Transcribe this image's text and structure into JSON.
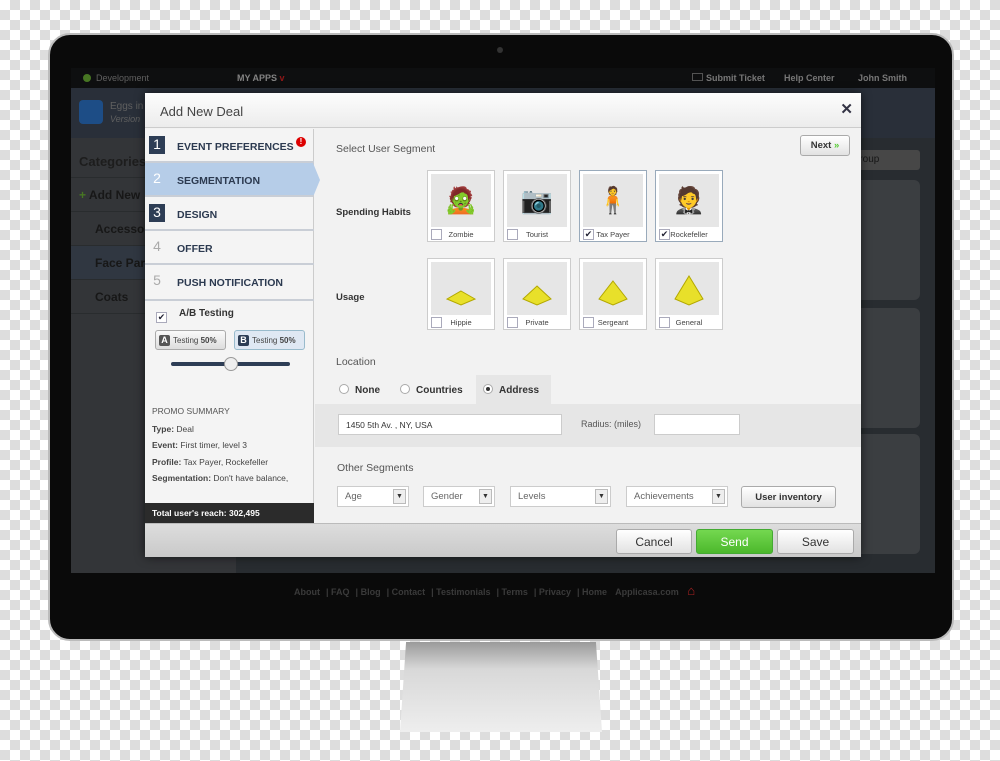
{
  "topbar": {
    "env": "Development",
    "my_apps": "MY APPS",
    "submit_ticket": "Submit Ticket",
    "help_center": "Help Center",
    "user": "John Smith"
  },
  "app": {
    "name": "Eggs in",
    "version": "Version"
  },
  "background": {
    "categories_title": "Categories",
    "add_new": "Add New",
    "items": [
      "Accessor",
      "Face Part",
      "Coats"
    ],
    "add_group": "ld Group"
  },
  "footer": {
    "links": [
      "About",
      "FAQ",
      "Blog",
      "Contact",
      "Testimonials",
      "Terms",
      "Privacy",
      "Home",
      "Applicasa.com"
    ]
  },
  "modal": {
    "title": "Add New Deal",
    "steps": [
      {
        "num": "1",
        "label": "EVENT PREFERENCES",
        "alert": "!"
      },
      {
        "num": "2",
        "label": "SEGMENTATION"
      },
      {
        "num": "3",
        "label": "DESIGN"
      },
      {
        "num": "4",
        "label": "OFFER"
      },
      {
        "num": "5",
        "label": "PUSH NOTIFICATION"
      }
    ],
    "ab_testing": {
      "label": "A/B Testing",
      "checked": true,
      "a": {
        "letter": "A",
        "text": "Testing",
        "pct": "50%"
      },
      "b": {
        "letter": "B",
        "text": "Testing",
        "pct": "50%"
      },
      "split_percent": 50
    },
    "summary": {
      "title": "PROMO SUMMARY",
      "rows": [
        {
          "k": "Type:",
          "v": "Deal"
        },
        {
          "k": "Event:",
          "v": "First timer, level 3"
        },
        {
          "k": "Profile:",
          "v": "Tax Payer, Rockefeller"
        },
        {
          "k": "Segmentation:",
          "v": "Don't have balance,"
        }
      ]
    },
    "reach": "Total user's reach: 302,495",
    "segment_title": "Select User Segment",
    "next": "Next",
    "spending_label": "Spending Habits",
    "spending": [
      {
        "label": "Zombie",
        "checked": false,
        "icon": "zombie"
      },
      {
        "label": "Tourist",
        "checked": false,
        "icon": "tourist"
      },
      {
        "label": "Tax Payer",
        "checked": true,
        "icon": "tax-payer"
      },
      {
        "label": "Rockefeller",
        "checked": true,
        "icon": "rockefeller"
      }
    ],
    "usage_label": "Usage",
    "usage": [
      {
        "label": "Hippie",
        "checked": false
      },
      {
        "label": "Private",
        "checked": false
      },
      {
        "label": "Sergeant",
        "checked": false
      },
      {
        "label": "General",
        "checked": false
      }
    ],
    "location_title": "Location",
    "location_options": [
      {
        "label": "None",
        "selected": false
      },
      {
        "label": "Countries",
        "selected": false
      },
      {
        "label": "Address",
        "selected": true
      }
    ],
    "address_value": "1450 5th Av. , NY, USA",
    "radius_label": "Radius: (miles)",
    "radius_value": "",
    "other_title": "Other Segments",
    "dropdowns": [
      "Age",
      "Gender",
      "Levels",
      "Achievements"
    ],
    "user_inventory": "User inventory",
    "cancel": "Cancel",
    "send": "Send",
    "save": "Save",
    "colors": {
      "send": "#5cc83a",
      "active_step": "#b6cde8",
      "step_num": "#2d3d55"
    }
  }
}
